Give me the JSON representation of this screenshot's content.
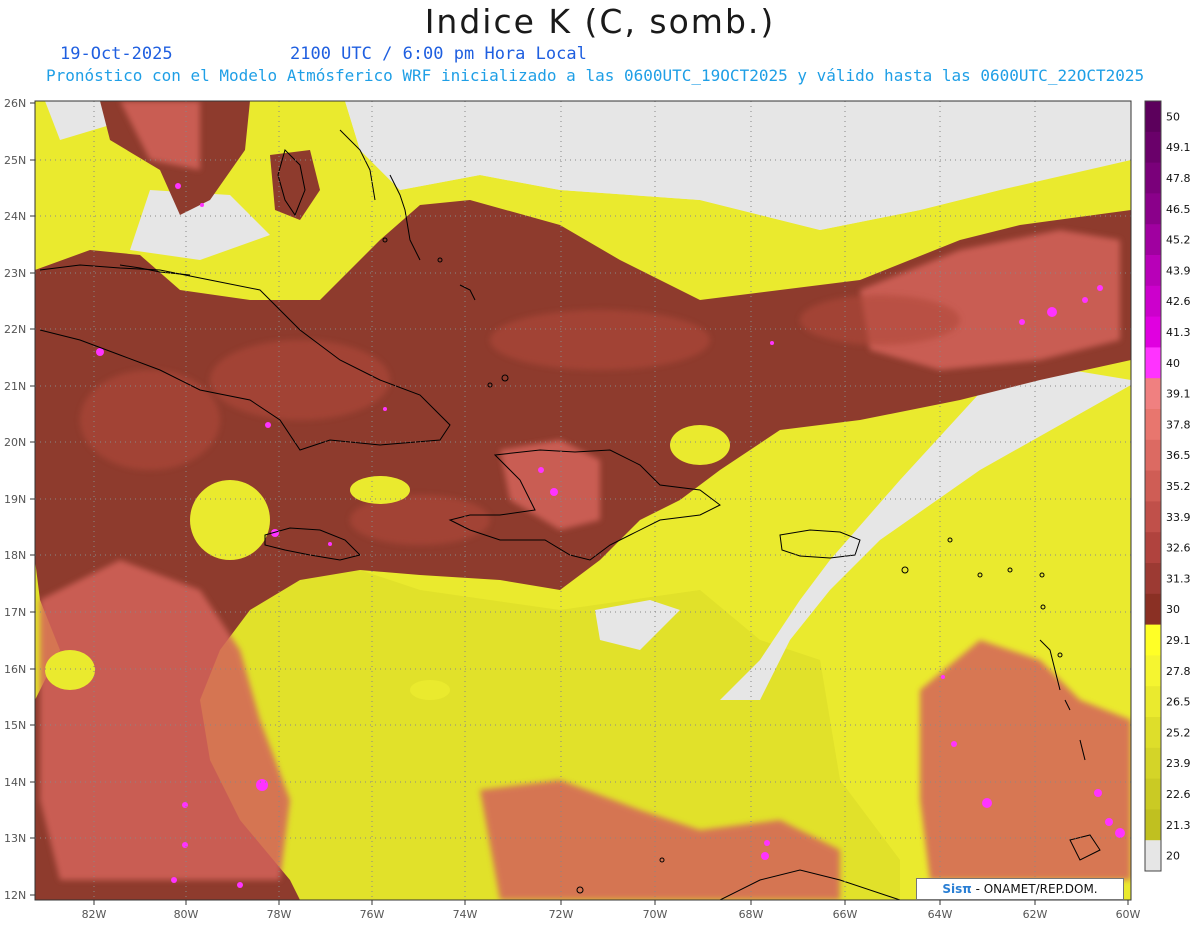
{
  "title": "Indice K (C, somb.)",
  "date": "19-Oct-2025",
  "time": "2100 UTC / 6:00 pm Hora Local",
  "subtitle": "Pronóstico con el Modelo Atmósferico WRF inicializado a las 0600UTC_19OCT2025 y válido hasta las  0600UTC_22OCT2025",
  "credit": {
    "logo": "Sisπ",
    "text": " - ONAMET/REP.DOM."
  },
  "lat_labels": [
    "26N",
    "25N",
    "24N",
    "23N",
    "22N",
    "21N",
    "20N",
    "19N",
    "18N",
    "17N",
    "16N",
    "15N",
    "14N",
    "13N",
    "12N"
  ],
  "lon_labels": [
    "82W",
    "80W",
    "78W",
    "76W",
    "74W",
    "72W",
    "70W",
    "68W",
    "66W",
    "64W",
    "62W",
    "60W"
  ],
  "colorbar": {
    "labels": [
      "50",
      "49.1",
      "47.8",
      "46.5",
      "45.2",
      "43.9",
      "42.6",
      "41.3",
      "40",
      "39.1",
      "37.8",
      "36.5",
      "35.2",
      "33.9",
      "32.6",
      "31.3",
      "30",
      "29.1",
      "27.8",
      "26.5",
      "25.2",
      "23.9",
      "22.6",
      "21.3",
      "20"
    ],
    "colors": [
      "#5c005c",
      "#6a006a",
      "#7a007a",
      "#8a008a",
      "#a000a0",
      "#b800b8",
      "#cc00cc",
      "#e000e0",
      "#ff33ff",
      "#f08080",
      "#e8766e",
      "#dc6a62",
      "#cf5d55",
      "#c0504a",
      "#b0433e",
      "#9c3a33",
      "#8a3024",
      "#ffff26",
      "#f5f530",
      "#eaea2e",
      "#dede2a",
      "#d4d428",
      "#caca24",
      "#c0c020",
      "#e6e6e6"
    ]
  },
  "palette": {
    "background": "#e6e6e6",
    "yellow_band": "#eaea2e",
    "yellow_mid": "#d8d828",
    "brown_dark": "#8a3a2c",
    "brown_mid": "#a8473a",
    "salmon": "#d9665c",
    "magenta": "#ff33ff",
    "title_blue": "#1f5fe0",
    "subtitle_blue": "#1f9fe6"
  }
}
